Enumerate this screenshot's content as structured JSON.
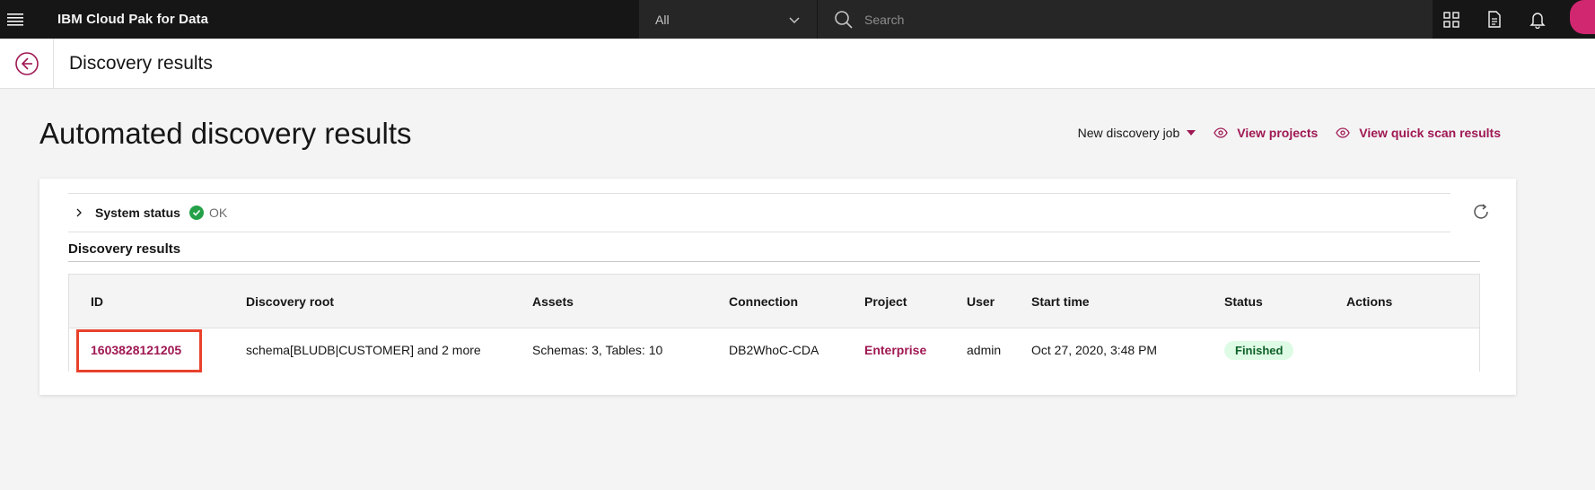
{
  "topbar": {
    "brand": "IBM Cloud Pak for Data",
    "scope_value": "All",
    "search_placeholder": "Search",
    "icons": [
      "hamburger-menu-icon",
      "chevron-down-icon",
      "search-icon",
      "app-switcher-icon",
      "document-icon",
      "notification-bell-icon",
      "user-avatar"
    ]
  },
  "subheader": {
    "title": "Discovery results",
    "back_icon": "back-arrow-circle-icon"
  },
  "main": {
    "heading": "Automated discovery results",
    "new_job_label": "New discovery job",
    "view_projects_label": "View projects",
    "view_quick_scan_label": "View quick scan results"
  },
  "system_status": {
    "label": "System status",
    "value": "OK"
  },
  "results": {
    "section_title": "Discovery results",
    "columns": {
      "id": "ID",
      "root": "Discovery root",
      "assets": "Assets",
      "connection": "Connection",
      "project": "Project",
      "user": "User",
      "start": "Start time",
      "status": "Status",
      "actions": "Actions"
    },
    "rows": [
      {
        "id": "1603828121205",
        "root": "schema[BLUDB|CUSTOMER] and 2 more",
        "assets": "Schemas: 3, Tables: 10",
        "connection": "DB2WhoC-CDA",
        "project": "Enterprise",
        "user": "admin",
        "start": "Oct 27, 2020, 3:48 PM",
        "status": "Finished"
      }
    ]
  },
  "colors": {
    "accent": "#9f1853",
    "topbar": "#161616",
    "highlight_box": "#e8412c",
    "success": "#24a148",
    "status_tag_bg": "#defbe6"
  }
}
